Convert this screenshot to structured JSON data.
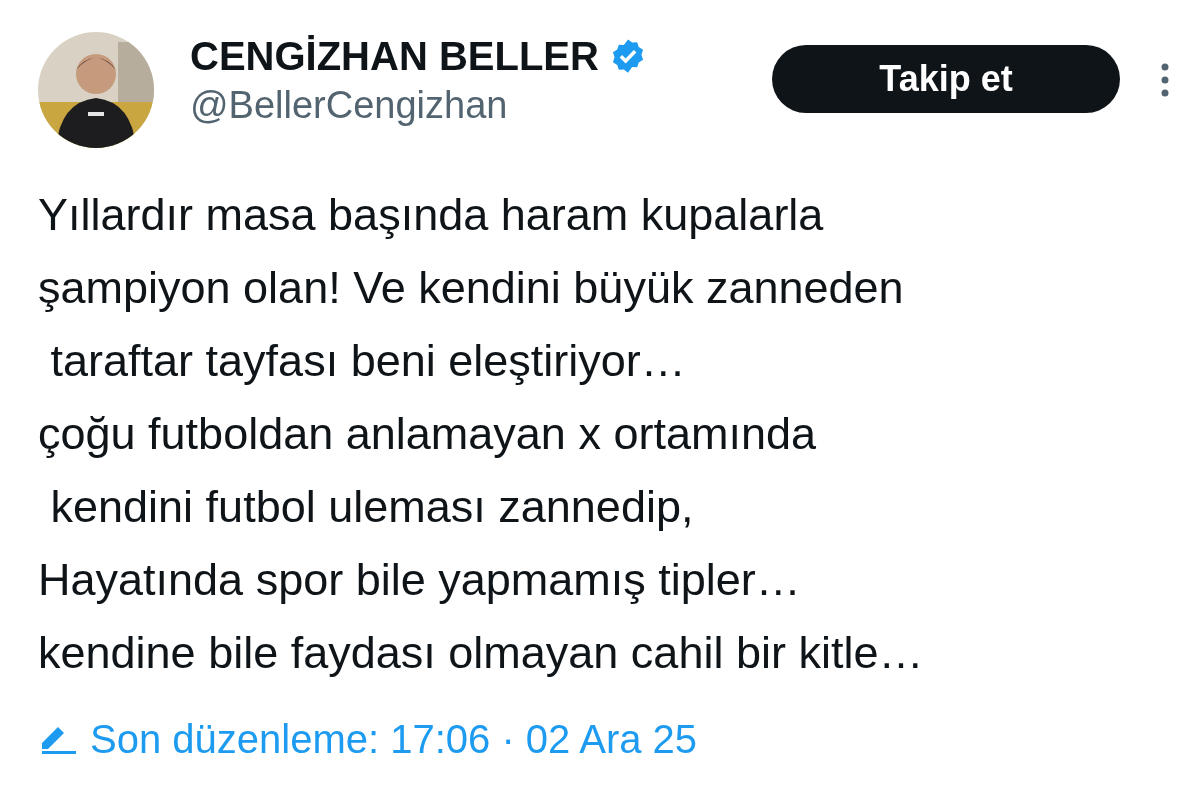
{
  "author": {
    "name": "CENGİZHAN BELLER",
    "verified": true,
    "handle": "@BellerCengizhan"
  },
  "follow_button": {
    "label": "Takip et"
  },
  "tweet": {
    "text": "Yıllardır masa başında haram kupalarla\nşampiyon olan! Ve kendini büyük zanneden\n taraftar tayfası beni eleştiriyor…\nçoğu futboldan anlamayan x ortamında\n kendini futbol uleması zannedip,\nHayatında spor bile yapmamış tipler…\nkendine bile faydası olmayan cahil bir kitle…"
  },
  "footer": {
    "edited": true,
    "text": "Son düzenleme: 17:06 · 02 Ara 25"
  }
}
